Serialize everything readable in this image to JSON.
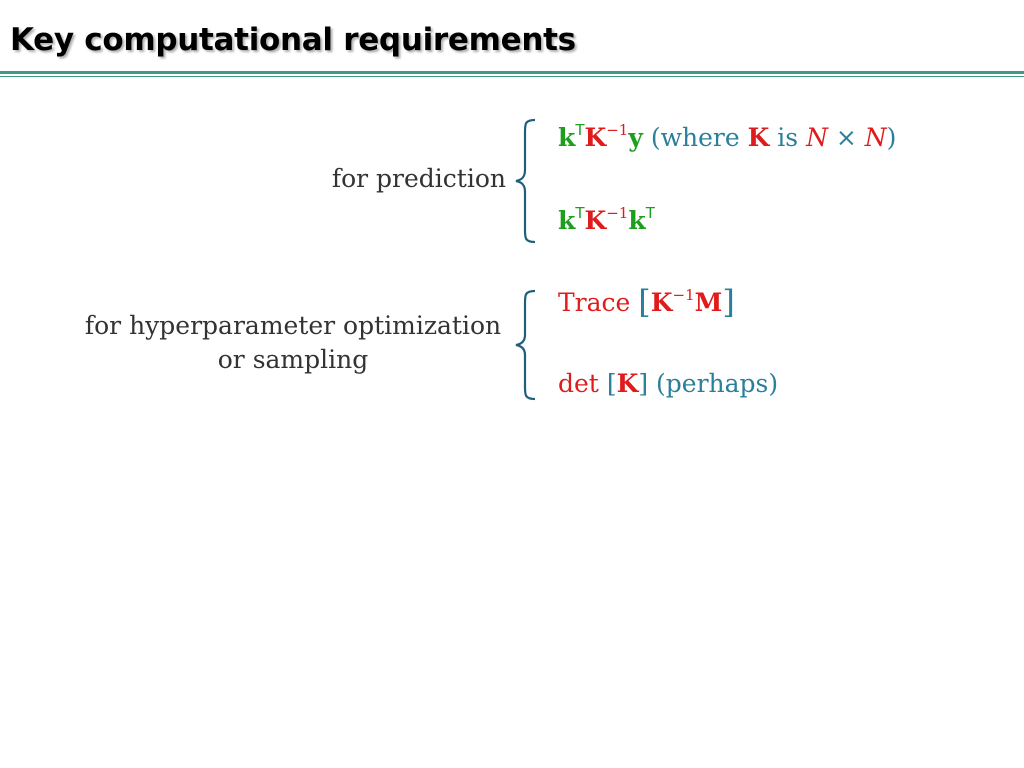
{
  "slide": {
    "title": "Key computational requirements"
  },
  "groups": [
    {
      "label": "for prediction",
      "formula_1": {
        "k": "k",
        "T": "T",
        "K": "K",
        "inv": "−1",
        "y": "y",
        "where_open": "(where",
        "K2": "K",
        "is": "is",
        "N1": "N",
        "times": "×",
        "N2": "N",
        "close": ")"
      },
      "formula_2": {
        "k": "k",
        "T": "T",
        "K": "K",
        "inv": "−1",
        "k2": "k",
        "T2": "T"
      }
    },
    {
      "label_line_1": "for hyperparameter optimization",
      "label_line_2": "or sampling",
      "formula_1": {
        "trace": "Trace",
        "lbr": "[",
        "K": "K",
        "inv": "−1",
        "M": "M",
        "rbr": "]"
      },
      "formula_2": {
        "det": "det",
        "lbr": "[",
        "K": "K",
        "rbr": "]",
        "perhaps": "(perhaps)"
      }
    }
  ],
  "colors": {
    "rule": "#3d9a8b",
    "green": "#1d9f1d",
    "red": "#e01b1b",
    "teal": "#2a7f9a",
    "brace": "#1f5f7a"
  }
}
